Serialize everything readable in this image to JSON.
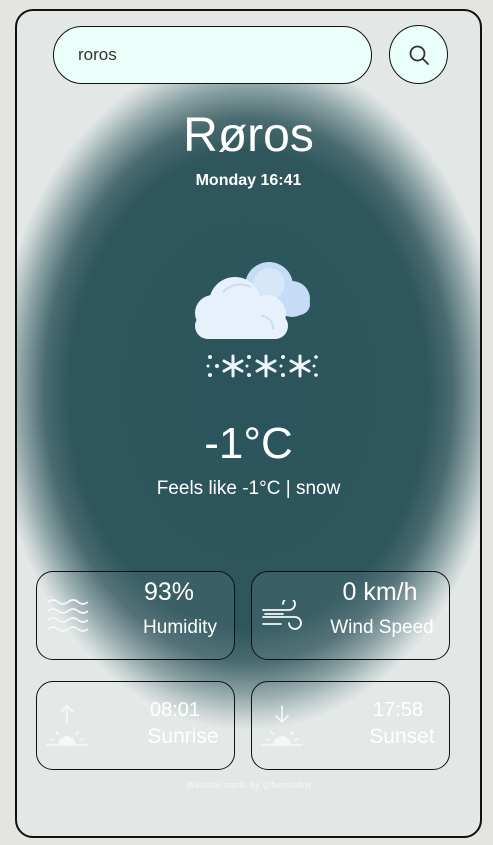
{
  "search": {
    "value": "roros",
    "button_icon": "search-icon"
  },
  "location": {
    "city": "Røros",
    "datetime": "Monday 16:41"
  },
  "weather": {
    "icon": "snow-cloud-icon",
    "temperature": "-1°C",
    "feels_like": "Feels like -1°C | snow"
  },
  "stats": {
    "humidity": {
      "value": "93%",
      "label": "Humidity",
      "icon": "humidity-waves-icon"
    },
    "wind": {
      "value": "0 km/h",
      "label": "Wind Speed",
      "icon": "wind-icon"
    },
    "sunrise": {
      "value": "08:01",
      "label": "Sunrise",
      "icon": "sunrise-icon"
    },
    "sunset": {
      "value": "17:58",
      "label": "Sunset",
      "icon": "sunset-icon"
    }
  },
  "footer": {
    "credit": "Website made by @hermidrn"
  },
  "colors": {
    "card_center": "#2c545c",
    "search_bg": "#eafffa",
    "text": "#ffffff"
  }
}
